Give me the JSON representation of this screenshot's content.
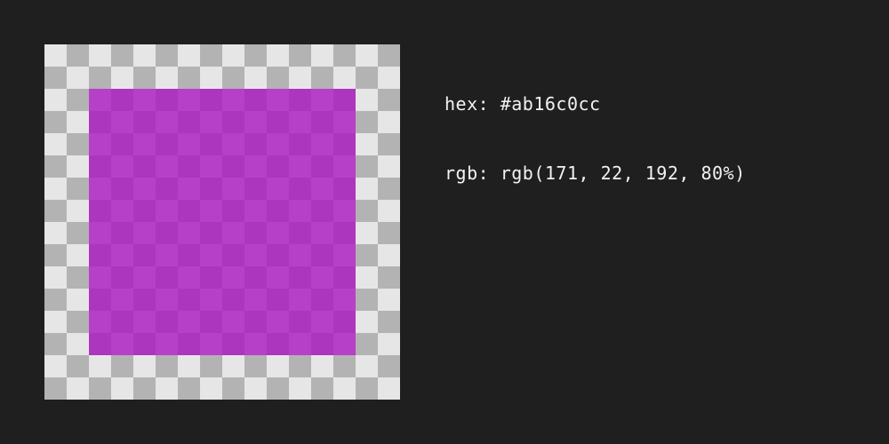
{
  "swatch": {
    "color": "#ab16c0cc"
  },
  "info": {
    "hex_label": "hex:",
    "hex_value": "#ab16c0cc",
    "rgb_label": "rgb:",
    "rgb_value": "rgb(171, 22, 192, 80%)"
  }
}
